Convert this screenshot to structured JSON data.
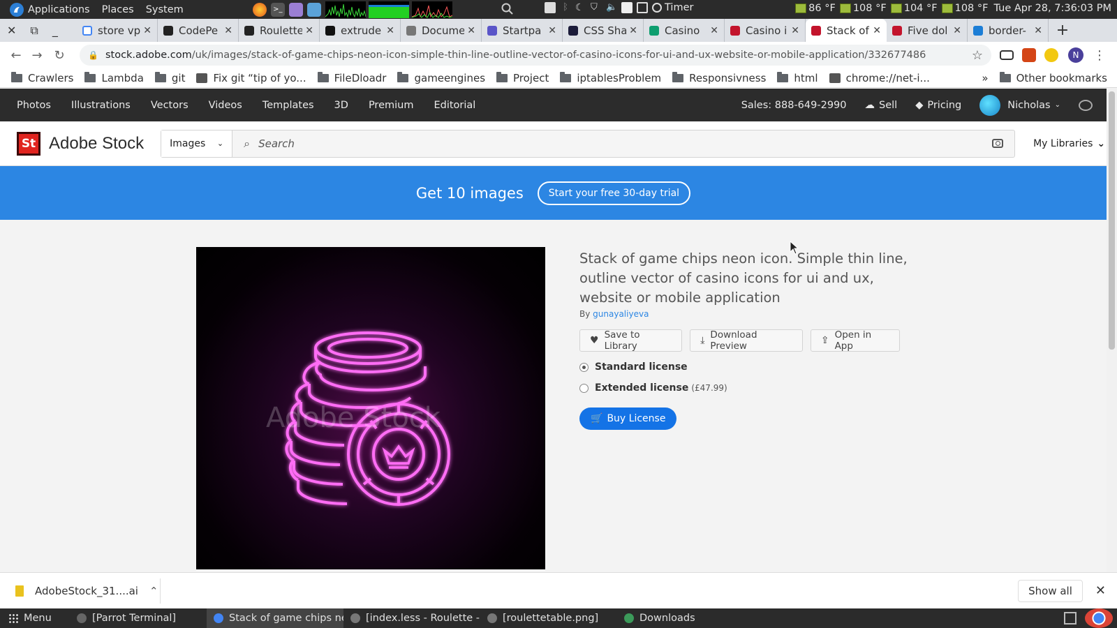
{
  "os_panel": {
    "menus": [
      "Applications",
      "Places",
      "System"
    ],
    "timer_label": "Timer",
    "temps": [
      "86 °F",
      "108 °F",
      "104 °F",
      "108 °F"
    ],
    "clock": "Tue Apr 28,  7:36:03 PM"
  },
  "browser": {
    "tabs": [
      {
        "title": "store vp",
        "color": "#ffffff",
        "icon": "google-icon"
      },
      {
        "title": "CodePe",
        "color": "#222222",
        "icon": "codepen-icon"
      },
      {
        "title": "Roulette",
        "color": "#222222",
        "icon": "codepen-icon"
      },
      {
        "title": "extrude",
        "color": "#111111",
        "icon": "github-icon"
      },
      {
        "title": "Docume",
        "color": "#777777",
        "icon": "globe-icon"
      },
      {
        "title": "Startpa",
        "color": "#5a55c8",
        "icon": "startpage-icon"
      },
      {
        "title": "CSS Sha",
        "color": "#1c1c3a",
        "icon": "css-icon"
      },
      {
        "title": "Casino",
        "color": "#0e9e6f",
        "icon": "vector-icon"
      },
      {
        "title": "Casino i",
        "color": "#c3142c",
        "icon": "adobe-stock-icon"
      },
      {
        "title": "Stack of",
        "color": "#c3142c",
        "icon": "adobe-stock-icon",
        "active": true
      },
      {
        "title": "Five dol",
        "color": "#c3142c",
        "icon": "adobe-stock-icon"
      },
      {
        "title": "border-",
        "color": "#1c7ed6",
        "icon": "mdn-icon"
      }
    ],
    "url_domain": "stock.adobe.com",
    "url_path": "/uk/images/stack-of-game-chips-neon-icon-simple-thin-line-outline-vector-of-casino-icons-for-ui-and-ux-website-or-mobile-application/332677486",
    "profile_initial": "N",
    "bookmarks": [
      {
        "label": "Crawlers",
        "type": "folder"
      },
      {
        "label": "Lambda",
        "type": "folder"
      },
      {
        "label": "git",
        "type": "folder"
      },
      {
        "label": "Fix git “tip of yo...",
        "type": "page"
      },
      {
        "label": "FileDloadr",
        "type": "folder"
      },
      {
        "label": "gameengines",
        "type": "folder"
      },
      {
        "label": "Project",
        "type": "folder"
      },
      {
        "label": "iptablesProblem",
        "type": "folder"
      },
      {
        "label": "Responsivness",
        "type": "folder"
      },
      {
        "label": "html",
        "type": "folder"
      },
      {
        "label": "chrome://net-i...",
        "type": "page"
      }
    ],
    "bookmarks_more": "»",
    "other_bookmarks": "Other bookmarks"
  },
  "site": {
    "nav": [
      "Photos",
      "Illustrations",
      "Vectors",
      "Videos",
      "Templates",
      "3D",
      "Premium",
      "Editorial"
    ],
    "sales": "Sales: 888-649-2990",
    "sell": "Sell",
    "pricing": "Pricing",
    "user": "Nicholas",
    "logo_text": "St",
    "brand": "Adobe Stock",
    "search_type": "Images",
    "search_placeholder": "Search",
    "my_libraries": "My Libraries",
    "promo_text": "Get 10 images",
    "promo_button": "Start your free 30-day trial",
    "accent": "#2c86e3"
  },
  "asset": {
    "title": "Stack of game chips neon icon. Simple thin line, outline vector of casino icons for ui and ux, website or mobile application",
    "by_label": "By",
    "author": "gunayaliyeva",
    "watermark": "Adobe Stock",
    "actions": [
      "Save to Library",
      "Download Preview",
      "Open in App"
    ],
    "licenses": [
      {
        "name": "Standard license",
        "price": "",
        "selected": true
      },
      {
        "name": "Extended license",
        "price": "(£47.99)",
        "selected": false
      }
    ],
    "buy_label": "Buy License",
    "neon_color": "#ff5ff0"
  },
  "downloads": {
    "file": "AdobeStock_31....ai",
    "show_all": "Show all"
  },
  "taskbar": {
    "menu": "Menu",
    "items": [
      {
        "label": "[Parrot Terminal]",
        "active": false
      },
      {
        "label": "Stack of game chips ne...",
        "active": true
      },
      {
        "label": "[index.less - Roulette - ...",
        "active": false
      },
      {
        "label": "[roulettetable.png]",
        "active": false
      },
      {
        "label": "Downloads",
        "active": false
      }
    ]
  }
}
